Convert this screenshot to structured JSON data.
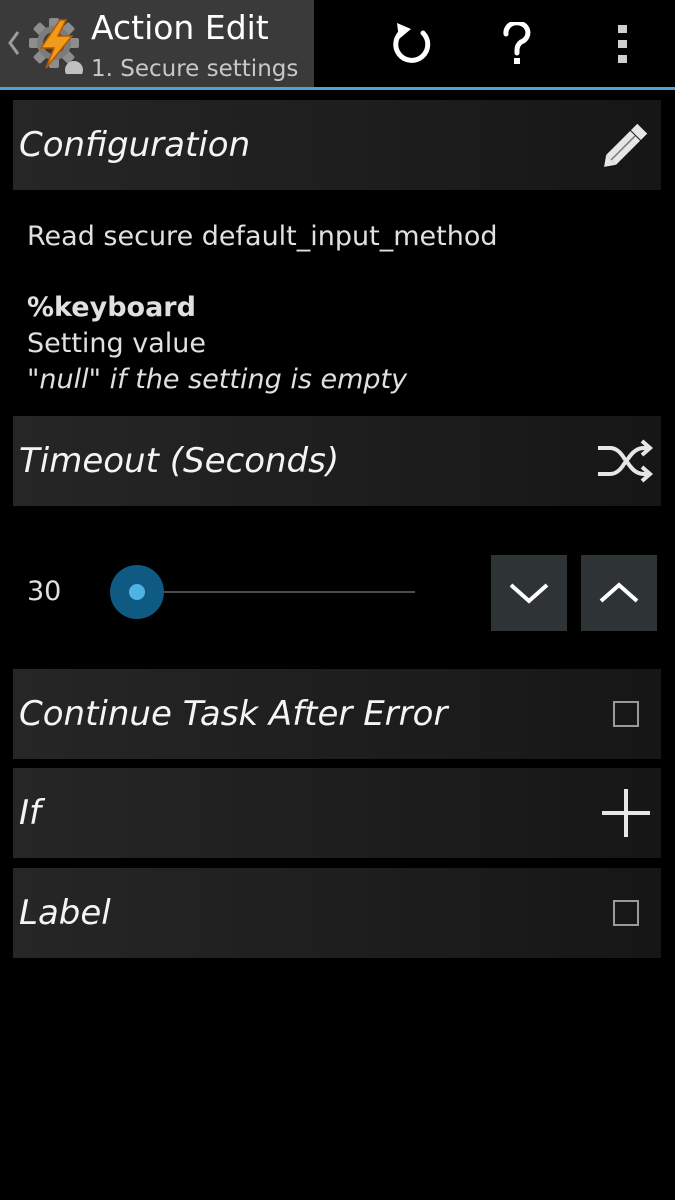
{
  "actionbar": {
    "title": "Action Edit",
    "subtitle": "1. Secure settings",
    "accent_color": "#4aa6d8",
    "icons": {
      "back": "chevron-left-icon",
      "app": "tasker-gear-bolt-icon",
      "reset": "reset-icon",
      "help": "help-icon",
      "more": "overflow-menu-icon"
    }
  },
  "configuration": {
    "header": "Configuration",
    "edit_icon": "pencil-icon",
    "description": "Read secure default_input_method",
    "variable_name": "%keyboard",
    "variable_desc": "Setting value",
    "variable_note": "\"null\" if the setting is empty"
  },
  "timeout": {
    "header": "Timeout (Seconds)",
    "toggle_icon": "shuffle-icon",
    "value": "30",
    "slider_fraction": 0.0,
    "decrement_icon": "chevron-down-icon",
    "increment_icon": "chevron-up-icon"
  },
  "continue_after_error": {
    "label": "Continue Task After Error",
    "checked": false
  },
  "if_condition": {
    "label": "If",
    "add_icon": "plus-icon"
  },
  "label_section": {
    "label": "Label",
    "checked": false
  }
}
